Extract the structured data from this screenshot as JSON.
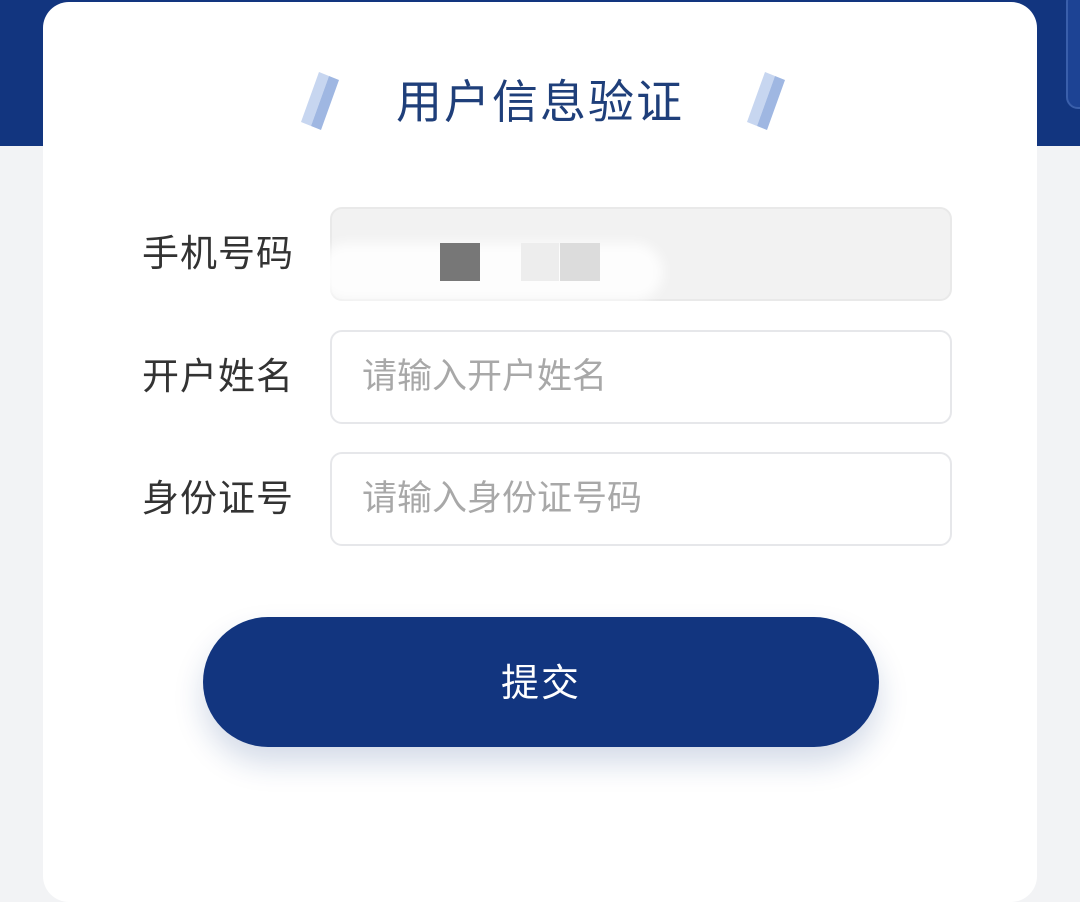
{
  "page": {
    "title": "用户信息验证"
  },
  "form": {
    "phone": {
      "label": "手机号码",
      "value": ""
    },
    "name": {
      "label": "开户姓名",
      "placeholder": "请输入开户姓名",
      "value": ""
    },
    "id_number": {
      "label": "身份证号",
      "placeholder": "请输入身份证号码",
      "value": ""
    },
    "submit_label": "提交"
  },
  "colors": {
    "brand_blue": "#12357f",
    "title_text": "#1f3f7a",
    "card_bg": "#ffffff",
    "page_bg": "#f2f3f5",
    "input_border": "#e6e7ea",
    "placeholder": "#a8a8a8"
  },
  "icons": {
    "title_left": "decorative-stripes-icon",
    "title_right": "decorative-stripes-icon"
  }
}
